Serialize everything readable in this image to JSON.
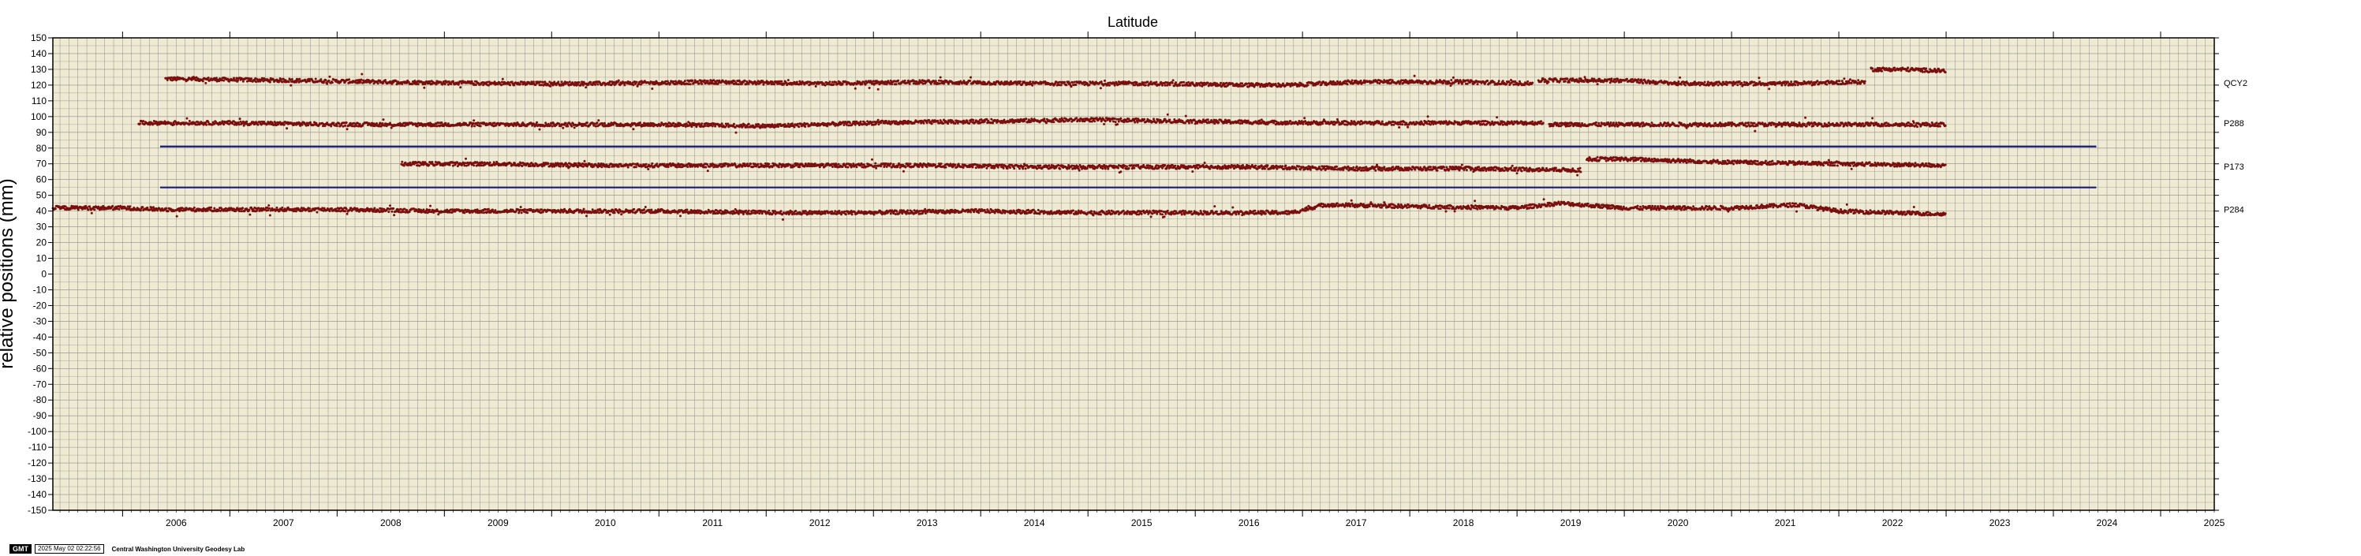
{
  "chart_data": {
    "type": "scatter",
    "title": "Latitude",
    "ylabel": "relative positions (mm)",
    "xlabel": "",
    "xlim": [
      2005.35,
      2025.5
    ],
    "ylim": [
      -150,
      150
    ],
    "grid": true,
    "background": "#efead3",
    "grid_color": "#8e8e84",
    "point_color": "#7a0f0f",
    "line_color": "#1a1a7a",
    "yticks": [
      150,
      140,
      130,
      120,
      110,
      100,
      90,
      80,
      70,
      60,
      50,
      40,
      30,
      20,
      10,
      0,
      -10,
      -20,
      -30,
      -40,
      -50,
      -60,
      -70,
      -80,
      -90,
      -100,
      -110,
      -120,
      -130,
      -140,
      -150
    ],
    "xticks": [
      "2006",
      "2007",
      "2008",
      "2009",
      "2010",
      "2011",
      "2012",
      "2013",
      "2014",
      "2015",
      "2016",
      "2017",
      "2018",
      "2019",
      "2020",
      "2021",
      "2022",
      "2023",
      "2024",
      "2025"
    ],
    "station_labels": [
      "QCY2",
      "P288",
      "P173",
      "P284"
    ],
    "series": [
      {
        "name": "QCY2",
        "segments": [
          {
            "x": [
              2006.4,
              2007.5,
              2008.5,
              2009.5,
              2010.5,
              2011.5,
              2012.5,
              2013.5,
              2014.5,
              2015.5,
              2016.5,
              2016.9,
              2017.5,
              2018.5,
              2019.15
            ],
            "y": [
              124,
              123,
              122,
              121,
              121,
              122,
              121,
              122,
              121,
              121,
              120,
              120,
              122,
              122,
              121
            ]
          },
          {
            "x": [
              2019.2,
              2020.0,
              2020.5,
              2021.5,
              2022.25
            ],
            "y": [
              123,
              123,
              121,
              121,
              122
            ]
          },
          {
            "x": [
              2022.3,
              2022.6,
              2023.0
            ],
            "y": [
              130,
              130,
              129
            ]
          }
        ]
      },
      {
        "name": "P288",
        "segments": [
          {
            "x": [
              2006.15,
              2007.0,
              2008.0,
              2009.0,
              2010.0,
              2011.0,
              2012.0,
              2013.0,
              2014.0,
              2015.0,
              2016.0,
              2017.0,
              2018.0,
              2019.25
            ],
            "y": [
              96,
              96,
              95,
              95,
              95,
              95,
              94,
              96,
              97,
              98,
              97,
              96,
              96,
              96
            ]
          },
          {
            "x": [
              2019.3,
              2020.0,
              2021.0,
              2022.0,
              2023.0
            ],
            "y": [
              95,
              95,
              95,
              95,
              95
            ]
          }
        ]
      },
      {
        "name": "P173",
        "segments": [
          {
            "x": [
              2008.6,
              2009.5,
              2010.5,
              2011.5,
              2012.5,
              2013.5,
              2014.5,
              2015.5,
              2016.5,
              2017.5,
              2018.5,
              2019.6
            ],
            "y": [
              70,
              70,
              69,
              69,
              69,
              69,
              68,
              68,
              68,
              67,
              67,
              66
            ]
          },
          {
            "x": [
              2019.65,
              2020.0,
              2021.0,
              2022.0,
              2023.0
            ],
            "y": [
              73,
              73,
              71,
              70,
              69
            ]
          }
        ]
      },
      {
        "name": "P284",
        "segments": [
          {
            "x": [
              2005.35,
              2006.0,
              2006.4,
              2007.0,
              2008.0,
              2009.0,
              2010.0,
              2011.0,
              2012.0,
              2013.0,
              2014.0,
              2015.0,
              2016.0,
              2016.9,
              2017.2,
              2018.0,
              2019.0,
              2019.4,
              2020.0,
              2021.0,
              2021.6,
              2022.0,
              2023.0
            ],
            "y": [
              42,
              42,
              41,
              41,
              41,
              40,
              40,
              40,
              39,
              39,
              40,
              39,
              39,
              39,
              44,
              43,
              42,
              45,
              42,
              42,
              44,
              40,
              38
            ]
          }
        ]
      }
    ],
    "reference_lines": [
      {
        "x": [
          2006.35,
          2024.4
        ],
        "y": [
          81,
          81
        ]
      },
      {
        "x": [
          2006.35,
          2024.4
        ],
        "y": [
          55,
          55
        ]
      }
    ]
  },
  "footer": {
    "logo": "GMT",
    "timestamp": "2025 May 02 02:22:56",
    "lab": "Central Washington University Geodesy Lab"
  }
}
